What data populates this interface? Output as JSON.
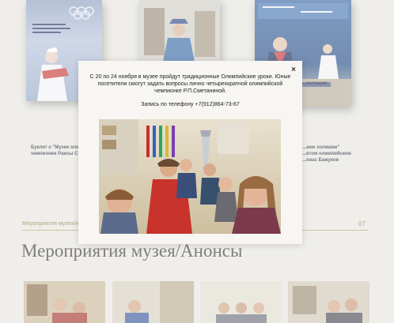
{
  "background_books": [
    {
      "cover_title": "Музей олимпийской чемпионки Раисы Сметаниной",
      "caption_lines": [
        "Буклет о \"Музее оли...",
        "чемпионки Раисы С..."
      ]
    },
    {
      "cover_title": "",
      "caption_lines": []
    },
    {
      "cover_title": "...холмами",
      "caption_lines": [
        "...ами холмами\"",
        "...ятом олимпийском",
        "...онас Бажуков"
      ]
    }
  ],
  "breadcrumb": "Мероприятия музея/Ан...",
  "page_number": "07",
  "section_title": "Мероприятия музея/Анонсы",
  "modal": {
    "close_label": "×",
    "text": "С 20 по 24 ноября в музее пройдут традиционные Олимпийские уроки. Юные посетители смогут задать вопросы лично четырехкратной олимпийской чемпионке Р.П.Сметаниной.",
    "phone": "Запись по телефону +7(912)864-73-67",
    "photo_description_icon": "photo-image"
  },
  "colors": {
    "background": "#e6e5df",
    "accent": "#b7a56a",
    "modal_bg": "#f7f6f2"
  }
}
